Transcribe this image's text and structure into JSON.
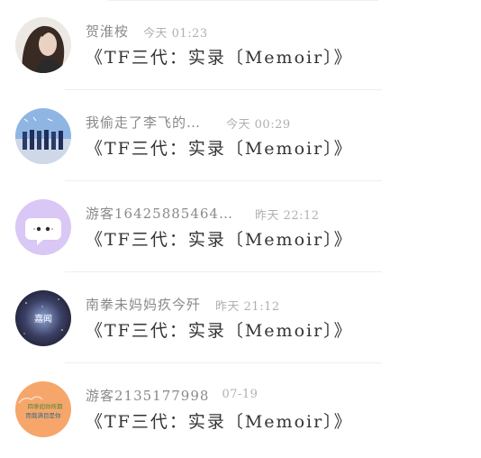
{
  "items": [
    {
      "name": "贺淮桉",
      "time": "今天 01:23",
      "title": "《TF三代：实录〔Memoir〕》",
      "avatar": "avatar-woman-dark-hair",
      "avatar_color": "#5a4a44"
    },
    {
      "name": "我偷走了李飞的…",
      "time": "今天 00:29",
      "title": "《TF三代：实录〔Memoir〕》",
      "avatar": "avatar-group-sky",
      "avatar_color": "#7aa7d8"
    },
    {
      "name": "游客1642588546​4…",
      "time": "昨天 22:12",
      "title": "《TF三代：实录〔Memoir〕》",
      "avatar": "avatar-default-chat-bubble",
      "avatar_color": "#d9c7f5"
    },
    {
      "name": "南拳未妈妈疚今歼",
      "time": "昨天 21:12",
      "title": "《TF三代：实录〔Memoir〕》",
      "avatar": "avatar-galaxy",
      "avatar_color": "#3b3f63",
      "avatar_text": "嘉闻"
    },
    {
      "name": "游客2135177998",
      "time": "07-19",
      "title": "《TF三代：实录〔Memoir〕》",
      "avatar": "avatar-orange-text",
      "avatar_color": "#f6a66a",
      "avatar_text_1": "四季如你所期",
      "avatar_text_2": "而我满目是你"
    }
  ]
}
